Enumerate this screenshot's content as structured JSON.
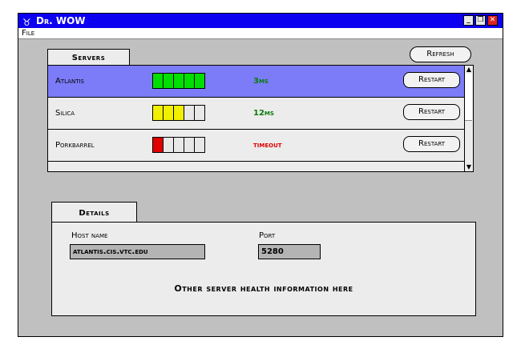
{
  "app": {
    "title": "Dr. WOW"
  },
  "menu": {
    "items": [
      {
        "label": "File"
      }
    ]
  },
  "servers": {
    "tab_label": "Servers",
    "refresh_label": "Refresh",
    "rows": [
      {
        "name": "Atlantis",
        "latency": "3ms",
        "latency_color": "#0a7a0a",
        "bar_color": "#00e000",
        "health": 5,
        "restart_label": "Restart",
        "selected": true
      },
      {
        "name": "Silica",
        "latency": "12ms",
        "latency_color": "#0a7a0a",
        "bar_color": "#f0f000",
        "health": 3,
        "restart_label": "Restart",
        "selected": false
      },
      {
        "name": "Porkbarrel",
        "latency": "timeout",
        "latency_color": "#e00000",
        "bar_color": "#e00000",
        "health": 1,
        "restart_label": "Restart",
        "selected": false
      }
    ]
  },
  "details": {
    "tab_label": "Details",
    "host_label": "Host name",
    "host_value": "atlantis.cis.vtc.edu",
    "port_label": "Port",
    "port_value": "5280",
    "info": "Other server health information here"
  },
  "colors": {
    "titlebar": "#0c00f0",
    "selected_row": "#7c7cf8",
    "window_bg": "#c0c0c0"
  }
}
